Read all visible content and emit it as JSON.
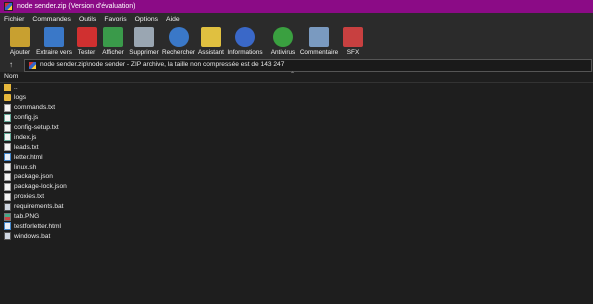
{
  "window": {
    "title": "node sender.zip (Version d'évaluation)"
  },
  "menu": [
    "Fichier",
    "Commandes",
    "Outils",
    "Favoris",
    "Options",
    "Aide"
  ],
  "toolbar": [
    {
      "label": "Ajouter",
      "icon": "add-archive-icon",
      "color": "#c8a030"
    },
    {
      "label": "Extraire vers",
      "icon": "extract-folder-icon",
      "color": "#3a78c8"
    },
    {
      "label": "Tester",
      "icon": "test-clipboard-icon",
      "color": "#d03030"
    },
    {
      "label": "Afficher",
      "icon": "view-book-icon",
      "color": "#3a9a4a"
    },
    {
      "label": "Supprimer",
      "icon": "delete-trash-icon",
      "color": "#9aa6b2"
    },
    {
      "label": "Rechercher",
      "icon": "search-magnifier-icon",
      "color": "#3a78c8"
    },
    {
      "label": "Assistant",
      "icon": "wizard-wand-icon",
      "color": "#e0c040"
    },
    {
      "label": "Informations",
      "icon": "info-icon",
      "color": "#3a68c8"
    },
    {
      "label": "Antivirus",
      "icon": "antivirus-icon",
      "color": "#3aa040"
    },
    {
      "label": "Commentaire",
      "icon": "comment-icon",
      "color": "#7a9ac0"
    },
    {
      "label": "SFX",
      "icon": "sfx-archive-icon",
      "color": "#c84040"
    }
  ],
  "address": {
    "path": "node sender.zip\\node sender - ZIP archive, la taille non compressée est de 143 247"
  },
  "columns": {
    "name": "Nom"
  },
  "files": [
    {
      "name": "..",
      "type": "up"
    },
    {
      "name": "logs",
      "type": "folder"
    },
    {
      "name": "commands.txt",
      "type": "txt"
    },
    {
      "name": "config.js",
      "type": "js"
    },
    {
      "name": "config-setup.txt",
      "type": "txt"
    },
    {
      "name": "index.js",
      "type": "js"
    },
    {
      "name": "leads.txt",
      "type": "txt"
    },
    {
      "name": "letter.html",
      "type": "html"
    },
    {
      "name": "linux.sh",
      "type": "sh"
    },
    {
      "name": "package.json",
      "type": "txt"
    },
    {
      "name": "package-lock.json",
      "type": "txt"
    },
    {
      "name": "proxies.txt",
      "type": "txt"
    },
    {
      "name": "requirements.bat",
      "type": "bat"
    },
    {
      "name": "tab.PNG",
      "type": "png"
    },
    {
      "name": "testforletter.html",
      "type": "html"
    },
    {
      "name": "windows.bat",
      "type": "bat"
    }
  ]
}
